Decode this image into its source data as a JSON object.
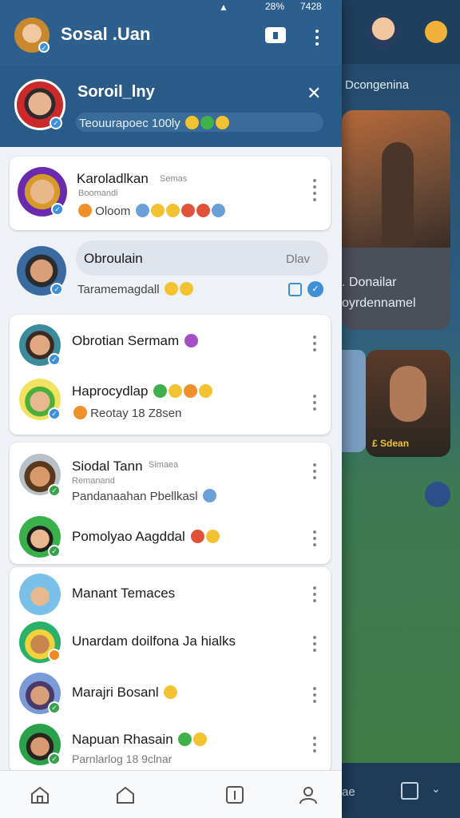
{
  "status_bar": {
    "battery": "28%",
    "time": "7428"
  },
  "header": {
    "title": "Sosal .Uan"
  },
  "profile": {
    "name": "Soroil_lny",
    "status": "Teouurapoec 100ly"
  },
  "background": {
    "header_label": "Dcongenina",
    "card_caption_line1": ". Donailar",
    "card_caption_line2": "oyrdennamel",
    "thumb_caption": "£ Sdean",
    "bottom_label": "ae"
  },
  "chats": [
    {
      "name": "Karoladlkan",
      "tag": "Semas",
      "sub": "Boomandi",
      "message": "Oloom"
    },
    {
      "name": "Obroulain",
      "action": "Dlav",
      "message": "Taramemagdall"
    },
    {
      "name": "Obrotian Sermam",
      "message": ""
    },
    {
      "name": "Haprocydlap",
      "message": "Reotay 18 Z8sen"
    },
    {
      "name": "Siodal Tann",
      "tag": "Simaea",
      "sub": "Remanand",
      "message": "Pandanaahan Pbellkasl"
    },
    {
      "name": "Pomolyao Aagddal",
      "message": ""
    },
    {
      "name": "Manant Temaces",
      "message": ""
    },
    {
      "name": "Unardam doilfona Ja hialks",
      "message": ""
    },
    {
      "name": "Marajri Bosanl",
      "message": ""
    },
    {
      "name": "Napuan Rhasain",
      "message": "Parnlarlog 18 9clnar"
    }
  ],
  "colors": {
    "header_bg": "#2d5f8e",
    "profile_bg": "#2a5a87",
    "verified": "#3d8fd6",
    "drawer_bg": "#eef1f5"
  },
  "nav": [
    "home-icon",
    "house-icon",
    "info-icon",
    "profile-icon"
  ]
}
